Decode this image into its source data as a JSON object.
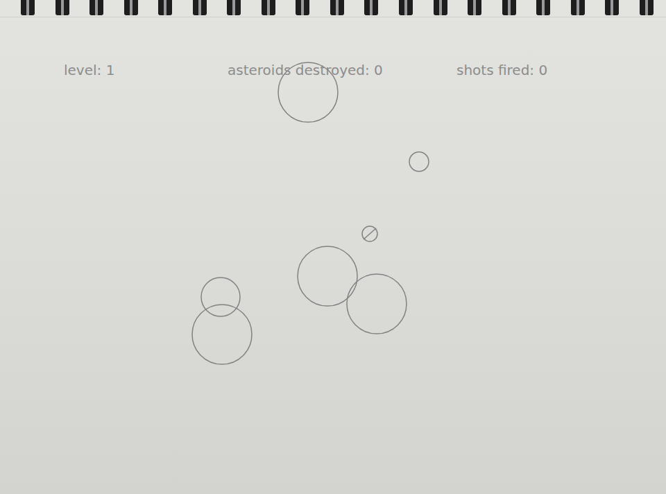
{
  "hud": {
    "level": "level: 1",
    "destroyed": "asteroids destroyed: 0",
    "shots": "shots fired: 0"
  },
  "asteroids": [
    {
      "kind": "large"
    },
    {
      "kind": "small"
    },
    {
      "kind": "large"
    },
    {
      "kind": "large"
    },
    {
      "kind": "medium"
    },
    {
      "kind": "large"
    }
  ]
}
